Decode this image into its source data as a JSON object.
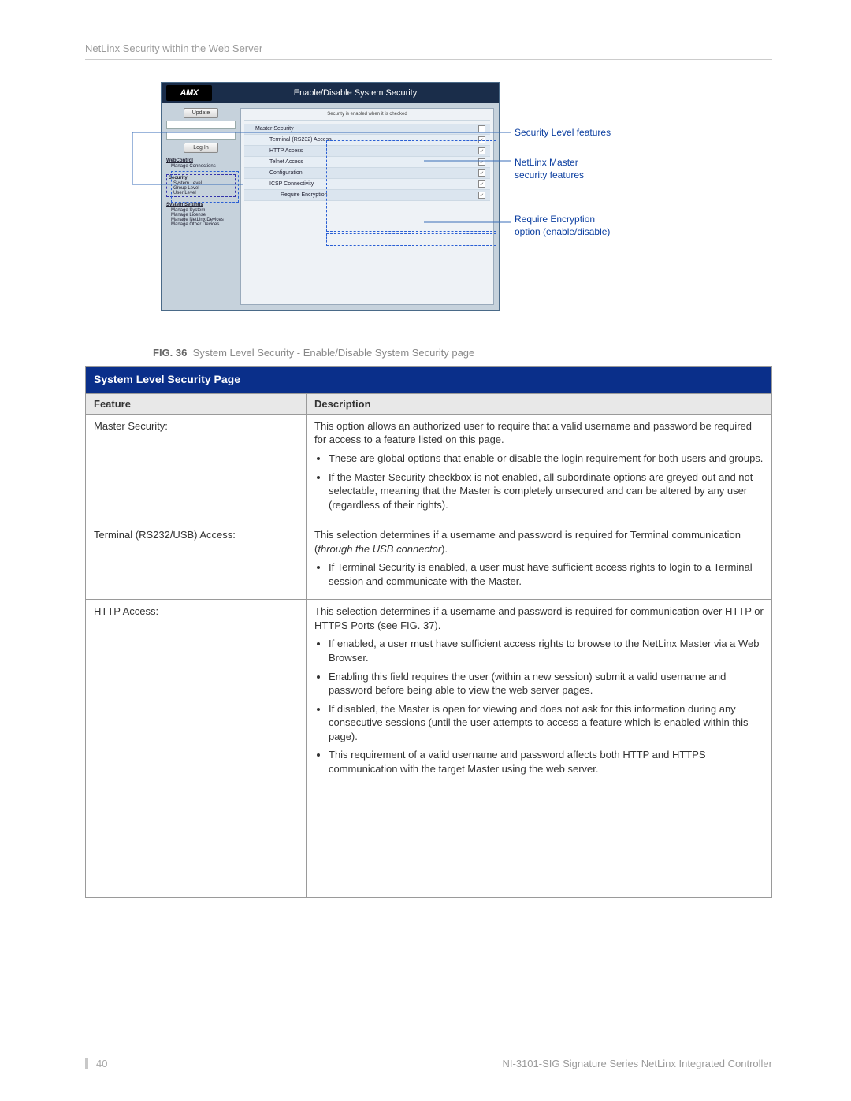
{
  "header": {
    "section_title": "NetLinx Security within the Web Server"
  },
  "screenshot": {
    "logo": "AMX",
    "window_title": "Enable/Disable System Security",
    "update_btn": "Update",
    "login_btn": "Log In",
    "hint": "Security is enabled when it is checked",
    "nav": {
      "webcontrol": {
        "title": "WebControl",
        "items": [
          "Manage Connections"
        ]
      },
      "security": {
        "title": "Security",
        "items": [
          "System Level",
          "Group Level",
          "User Level"
        ]
      },
      "system": {
        "title": "System Settings",
        "items": [
          "Manage System",
          "Manage License",
          "Manage NetLinx Devices",
          "Manage Other Devices"
        ]
      }
    },
    "rows": [
      {
        "label": "Master Security",
        "checked": false
      },
      {
        "label": "Terminal (RS232) Access",
        "checked": true
      },
      {
        "label": "HTTP Access",
        "checked": true
      },
      {
        "label": "Telnet Access",
        "checked": true
      },
      {
        "label": "Configuration",
        "checked": true
      },
      {
        "label": "ICSP Connectivity",
        "checked": true
      },
      {
        "label": "Require Encryption",
        "checked": true,
        "indent": true
      }
    ]
  },
  "callouts": {
    "c1": "Security Level features",
    "c2a": "NetLinx Master",
    "c2b": "security features",
    "c3a": "Require Encryption",
    "c3b": "option (enable/disable)"
  },
  "figure": {
    "prefix": "FIG. 36",
    "text": "System Level Security - Enable/Disable System Security page"
  },
  "table": {
    "title": "System Level Security Page",
    "col1": "Feature",
    "col2": "Description",
    "rows": [
      {
        "feature": "Master Security:",
        "lead": "This option allows an authorized user to require that a valid username and password be required for access to a feature listed on this page.",
        "bullets": [
          "These are global options that enable or disable the login requirement for both users and groups.",
          "If the Master Security checkbox is not enabled, all subordinate options are greyed-out and not selectable, meaning that the Master is completely unsecured and can be altered by any user (regardless of their rights)."
        ]
      },
      {
        "feature": "Terminal (RS232/USB) Access:",
        "lead_html": "This selection determines if a username and password is required for Terminal communication (<em class='it'>through the USB connector</em>).",
        "bullets": [
          "If Terminal Security is enabled, a user must have sufficient access rights to login to a Terminal session and communicate with the Master."
        ]
      },
      {
        "feature": "HTTP Access:",
        "lead": "This selection determines if a username and password is required for communication over HTTP or HTTPS Ports (see FIG. 37).",
        "bullets": [
          "If enabled, a user must have sufficient access rights to browse to the NetLinx Master via a Web Browser.",
          "Enabling this field requires the user (within a new session) submit a valid username and password before being able to view the web server pages.",
          "If disabled, the Master is open for viewing and does not ask for this information during any consecutive sessions (until the user attempts to access a feature which is enabled within this page).",
          "This requirement of a valid username and password affects both HTTP and HTTPS communication with the target Master using the web server."
        ]
      }
    ]
  },
  "footer": {
    "page": "40",
    "doc": "NI-3101-SIG Signature Series NetLinx Integrated Controller"
  }
}
